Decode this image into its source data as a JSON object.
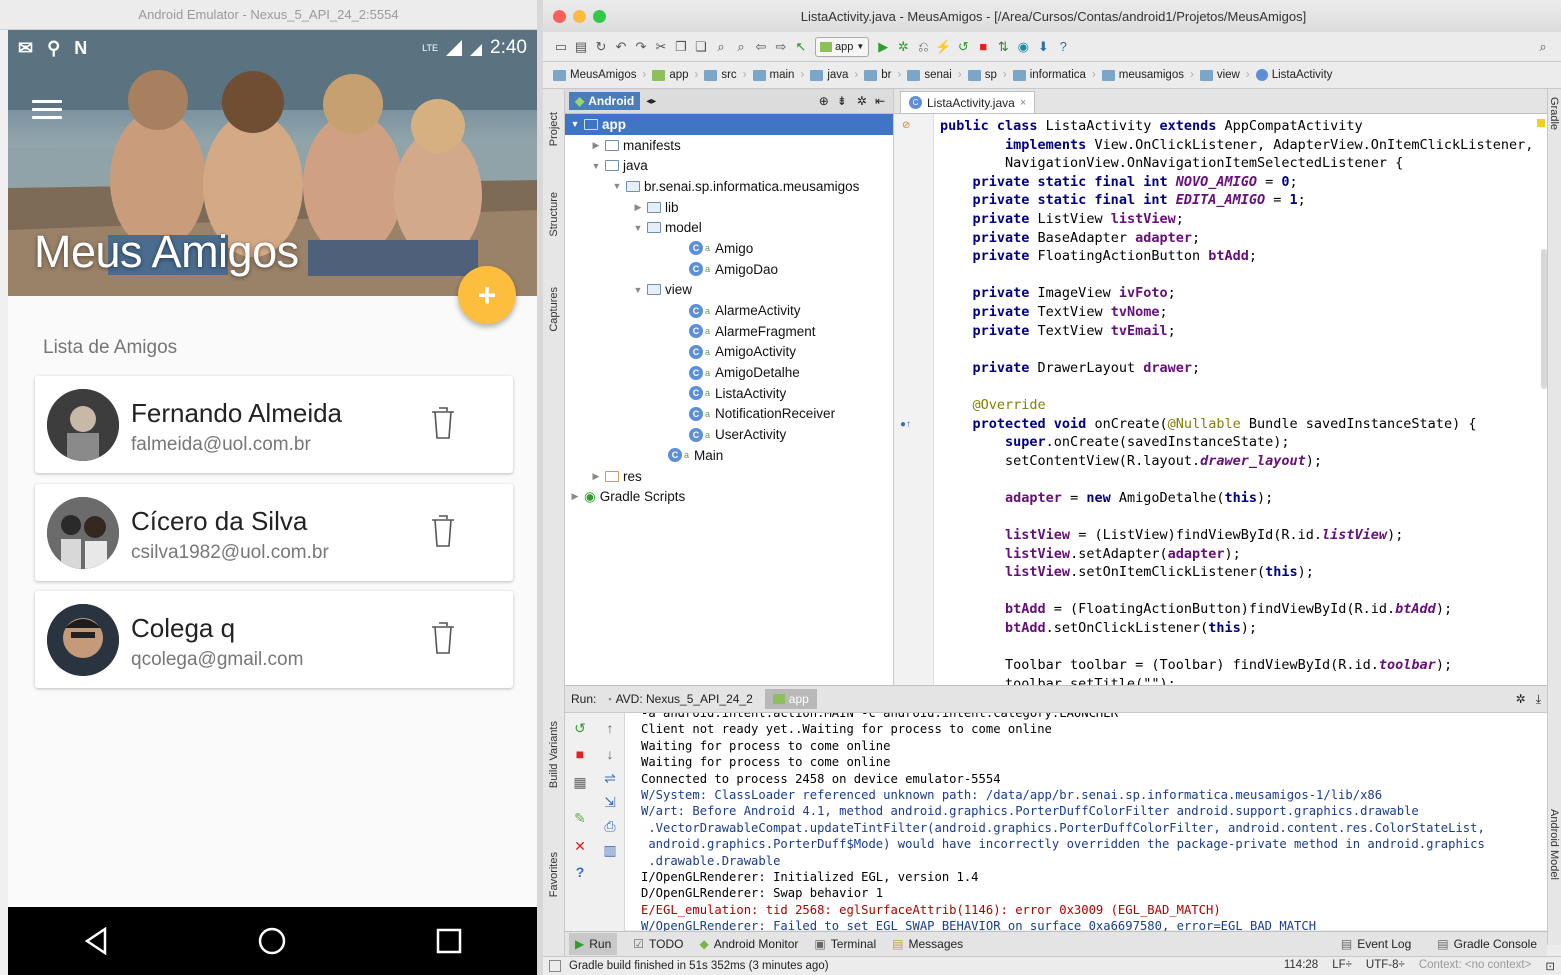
{
  "emulator": {
    "title": "Android Emulator - Nexus_5_API_24_2:5554",
    "status_time": "2:40",
    "status_network": "LTE",
    "app_title": "Meus Amigos",
    "fab_label": "+",
    "list_heading": "Lista de Amigos",
    "friends": [
      {
        "name": "Fernando Almeida",
        "email": "falmeida@uol.com.br"
      },
      {
        "name": "Cícero da Silva",
        "email": "csilva1982@uol.com.br"
      },
      {
        "name": "Colega q",
        "email": "qcolega@gmail.com"
      }
    ],
    "nav_buttons": [
      "back-icon",
      "home-icon",
      "recents-icon"
    ]
  },
  "ide": {
    "window_title": "ListaActivity.java - MeusAmigos - [/Area/Cursos/Contas/android1/Projetos/MeusAmigos]",
    "run_config": "app",
    "breadcrumb": [
      "MeusAmigos",
      "app",
      "src",
      "main",
      "java",
      "br",
      "senai",
      "sp",
      "informatica",
      "meusamigos",
      "view",
      "ListaActivity"
    ],
    "left_tabs": [
      "Project",
      "Structure",
      "Captures",
      "Build Variants",
      "Favorites"
    ],
    "right_tabs": [
      "Gradle",
      "Android Model"
    ],
    "project_mode": "Android",
    "tree": [
      {
        "label": "app",
        "depth": 0,
        "arrow": "▼",
        "kind": "module",
        "selected": true
      },
      {
        "label": "manifests",
        "depth": 1,
        "arrow": "▶",
        "kind": "folder"
      },
      {
        "label": "java",
        "depth": 1,
        "arrow": "▼",
        "kind": "folder"
      },
      {
        "label": "br.senai.sp.informatica.meusamigos",
        "depth": 2,
        "arrow": "▼",
        "kind": "package"
      },
      {
        "label": "lib",
        "depth": 3,
        "arrow": "▶",
        "kind": "package"
      },
      {
        "label": "model",
        "depth": 3,
        "arrow": "▼",
        "kind": "package"
      },
      {
        "label": "Amigo",
        "depth": 5,
        "arrow": "",
        "kind": "class"
      },
      {
        "label": "AmigoDao",
        "depth": 5,
        "arrow": "",
        "kind": "class"
      },
      {
        "label": "view",
        "depth": 3,
        "arrow": "▼",
        "kind": "package"
      },
      {
        "label": "AlarmeActivity",
        "depth": 5,
        "arrow": "",
        "kind": "class"
      },
      {
        "label": "AlarmeFragment",
        "depth": 5,
        "arrow": "",
        "kind": "class"
      },
      {
        "label": "AmigoActivity",
        "depth": 5,
        "arrow": "",
        "kind": "class"
      },
      {
        "label": "AmigoDetalhe",
        "depth": 5,
        "arrow": "",
        "kind": "class"
      },
      {
        "label": "ListaActivity",
        "depth": 5,
        "arrow": "",
        "kind": "class"
      },
      {
        "label": "NotificationReceiver",
        "depth": 5,
        "arrow": "",
        "kind": "class"
      },
      {
        "label": "UserActivity",
        "depth": 5,
        "arrow": "",
        "kind": "class"
      },
      {
        "label": "Main",
        "depth": 4,
        "arrow": "",
        "kind": "class"
      },
      {
        "label": "res",
        "depth": 1,
        "arrow": "▶",
        "kind": "res"
      },
      {
        "label": "Gradle Scripts",
        "depth": 0,
        "arrow": "▶",
        "kind": "gradle"
      }
    ],
    "editor_tab": "ListaActivity.java",
    "code_lines": [
      [
        [
          "kw",
          "public class "
        ],
        [
          "",
          "ListaActivity "
        ],
        [
          "kw",
          "extends "
        ],
        [
          "",
          "AppCompatActivity"
        ]
      ],
      [
        [
          "",
          "        "
        ],
        [
          "kw",
          "implements "
        ],
        [
          "",
          "View.OnClickListener, AdapterView.OnItemClickListener,"
        ]
      ],
      [
        [
          "",
          "        NavigationView.OnNavigationItemSelectedListener {"
        ]
      ],
      [
        [
          "",
          "    "
        ],
        [
          "kw",
          "private static final int "
        ],
        [
          "st",
          "NOVO_AMIGO"
        ],
        [
          "",
          " = "
        ],
        [
          "kw",
          "0"
        ],
        [
          "",
          ";"
        ]
      ],
      [
        [
          "",
          "    "
        ],
        [
          "kw",
          "private static final int "
        ],
        [
          "st",
          "EDITA_AMIGO"
        ],
        [
          "",
          " = "
        ],
        [
          "kw",
          "1"
        ],
        [
          "",
          ";"
        ]
      ],
      [
        [
          "",
          "    "
        ],
        [
          "kw",
          "private "
        ],
        [
          "",
          "ListView "
        ],
        [
          "fld",
          "listView"
        ],
        [
          "",
          ";"
        ]
      ],
      [
        [
          "",
          "    "
        ],
        [
          "kw",
          "private "
        ],
        [
          "",
          "BaseAdapter "
        ],
        [
          "fld",
          "adapter"
        ],
        [
          "",
          ";"
        ]
      ],
      [
        [
          "",
          "    "
        ],
        [
          "kw",
          "private "
        ],
        [
          "",
          "FloatingActionButton "
        ],
        [
          "fld",
          "btAdd"
        ],
        [
          "",
          ";"
        ]
      ],
      [
        [
          "",
          ""
        ]
      ],
      [
        [
          "",
          "    "
        ],
        [
          "kw",
          "private "
        ],
        [
          "",
          "ImageView "
        ],
        [
          "fld",
          "ivFoto"
        ],
        [
          "",
          ";"
        ]
      ],
      [
        [
          "",
          "    "
        ],
        [
          "kw",
          "private "
        ],
        [
          "",
          "TextView "
        ],
        [
          "fld",
          "tvNome"
        ],
        [
          "",
          ";"
        ]
      ],
      [
        [
          "",
          "    "
        ],
        [
          "kw",
          "private "
        ],
        [
          "",
          "TextView "
        ],
        [
          "fld",
          "tvEmail"
        ],
        [
          "",
          ";"
        ]
      ],
      [
        [
          "",
          ""
        ]
      ],
      [
        [
          "",
          "    "
        ],
        [
          "kw",
          "private "
        ],
        [
          "",
          "DrawerLayout "
        ],
        [
          "fld",
          "drawer"
        ],
        [
          "",
          ";"
        ]
      ],
      [
        [
          "",
          ""
        ]
      ],
      [
        [
          "",
          "    "
        ],
        [
          "ann",
          "@Override"
        ]
      ],
      [
        [
          "",
          "    "
        ],
        [
          "kw",
          "protected void "
        ],
        [
          "",
          "onCreate("
        ],
        [
          "ann",
          "@Nullable "
        ],
        [
          "",
          "Bundle savedInstanceState) {"
        ]
      ],
      [
        [
          "",
          "        "
        ],
        [
          "kw",
          "super"
        ],
        [
          "",
          ".onCreate(savedInstanceState);"
        ]
      ],
      [
        [
          "",
          "        setContentView(R.layout."
        ],
        [
          "st",
          "drawer_layout"
        ],
        [
          "",
          ");"
        ]
      ],
      [
        [
          "",
          ""
        ]
      ],
      [
        [
          "",
          "        "
        ],
        [
          "fld",
          "adapter"
        ],
        [
          "",
          " = "
        ],
        [
          "kw",
          "new "
        ],
        [
          "",
          "AmigoDetalhe("
        ],
        [
          "kw",
          "this"
        ],
        [
          "",
          ");"
        ]
      ],
      [
        [
          "",
          ""
        ]
      ],
      [
        [
          "",
          "        "
        ],
        [
          "fld",
          "listView"
        ],
        [
          "",
          " = (ListView)findViewById(R.id."
        ],
        [
          "st",
          "listView"
        ],
        [
          "",
          ");"
        ]
      ],
      [
        [
          "",
          "        "
        ],
        [
          "fld",
          "listView"
        ],
        [
          "",
          ".setAdapter("
        ],
        [
          "fld",
          "adapter"
        ],
        [
          "",
          ");"
        ]
      ],
      [
        [
          "",
          "        "
        ],
        [
          "fld",
          "listView"
        ],
        [
          "",
          ".setOnItemClickListener("
        ],
        [
          "kw",
          "this"
        ],
        [
          "",
          ");"
        ]
      ],
      [
        [
          "",
          ""
        ]
      ],
      [
        [
          "",
          "        "
        ],
        [
          "fld",
          "btAdd"
        ],
        [
          "",
          " = (FloatingActionButton)findViewById(R.id."
        ],
        [
          "st",
          "btAdd"
        ],
        [
          "",
          ");"
        ]
      ],
      [
        [
          "",
          "        "
        ],
        [
          "fld",
          "btAdd"
        ],
        [
          "",
          ".setOnClickListener("
        ],
        [
          "kw",
          "this"
        ],
        [
          "",
          ");"
        ]
      ],
      [
        [
          "",
          ""
        ]
      ],
      [
        [
          "",
          "        Toolbar toolbar = (Toolbar) findViewById(R.id."
        ],
        [
          "st",
          "toolbar"
        ],
        [
          "",
          ");"
        ]
      ],
      [
        [
          "",
          "        toolbar.setTitle(\"\");"
        ]
      ]
    ],
    "run_label": "Run:",
    "run_tabs": [
      "AVD: Nexus_5_API_24_2",
      "app"
    ],
    "console": [
      {
        "c": "#000",
        "t": "-a android.intent.action.MAIN -c android.intent.category.LAUNCHER"
      },
      {
        "c": "#000",
        "t": "Client not ready yet..Waiting for process to come online"
      },
      {
        "c": "#000",
        "t": "Waiting for process to come online"
      },
      {
        "c": "#000",
        "t": "Waiting for process to come online"
      },
      {
        "c": "#000",
        "t": "Connected to process 2458 on device emulator-5554"
      },
      {
        "c": "#1a3c8c",
        "t": "W/System: ClassLoader referenced unknown path: /data/app/br.senai.sp.informatica.meusamigos-1/lib/x86"
      },
      {
        "c": "#1a3c8c",
        "t": "W/art: Before Android 4.1, method android.graphics.PorterDuffColorFilter android.support.graphics.drawable"
      },
      {
        "c": "#1a3c8c",
        "t": " .VectorDrawableCompat.updateTintFilter(android.graphics.PorterDuffColorFilter, android.content.res.ColorStateList,"
      },
      {
        "c": "#1a3c8c",
        "t": " android.graphics.PorterDuff$Mode) would have incorrectly overridden the package-private method in android.graphics"
      },
      {
        "c": "#1a3c8c",
        "t": " .drawable.Drawable"
      },
      {
        "c": "#000",
        "t": "I/OpenGLRenderer: Initialized EGL, version 1.4"
      },
      {
        "c": "#000",
        "t": "D/OpenGLRenderer: Swap behavior 1"
      },
      {
        "c": "#b00000",
        "t": "E/EGL_emulation: tid 2568: eglSurfaceAttrib(1146): error 0x3009 (EGL_BAD_MATCH)"
      },
      {
        "c": "#1a3c8c",
        "t": "W/OpenGLRenderer: Failed to set EGL_SWAP_BEHAVIOR on surface 0xa6697580, error=EGL_BAD_MATCH"
      }
    ],
    "bottom_tabs": [
      {
        "label": "Run",
        "icon": "run-icon"
      },
      {
        "label": "TODO",
        "icon": "todo-icon"
      },
      {
        "label": "Android Monitor",
        "icon": "android-icon"
      },
      {
        "label": "Terminal",
        "icon": "terminal-icon"
      },
      {
        "label": "Messages",
        "icon": "messages-icon"
      }
    ],
    "bottom_right_tabs": [
      "Event Log",
      "Gradle Console"
    ],
    "status": "Gradle build finished in 51s 352ms (3 minutes ago)",
    "status_right": [
      "114:28",
      "LF÷",
      "UTF-8÷",
      "Context: <no context>"
    ]
  },
  "colors": {
    "fab": "#fdbd3d",
    "selection": "#3f75c4",
    "keyword": "#000080",
    "field": "#660e7a"
  }
}
